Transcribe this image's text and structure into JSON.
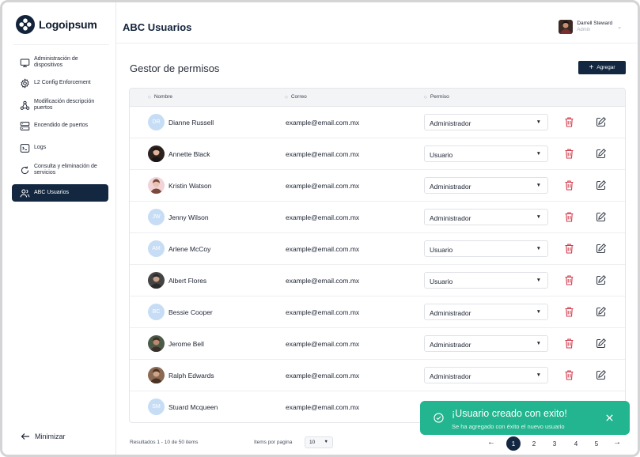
{
  "app": {
    "logo_text": "Logoipsum",
    "page_title": "ABC Usuarios"
  },
  "user": {
    "name": "Darrell Steward",
    "role": "Admin"
  },
  "sidebar": {
    "items": [
      {
        "label": "Administración de dispositivos",
        "icon": "monitor-icon",
        "active": false
      },
      {
        "label": "L2 Config Enforcement",
        "icon": "settings-icon",
        "active": false
      },
      {
        "label": "Modificación descripción puertos",
        "icon": "share-nodes-icon",
        "active": false
      },
      {
        "label": "Encendido de puertos",
        "icon": "server-icon",
        "active": false
      },
      {
        "label": "Logs",
        "icon": "terminal-icon",
        "active": false
      },
      {
        "label": "Consulta y eliminación de servicios",
        "icon": "refresh-icon",
        "active": false
      },
      {
        "label": "ABC Usuarios",
        "icon": "users-icon",
        "active": true
      }
    ],
    "minimize_label": "Minimizar"
  },
  "main": {
    "section_title": "Gestor de permisos",
    "add_button_label": "Agregar",
    "table": {
      "columns": [
        "Nombre",
        "Correo",
        "Permiso"
      ],
      "rows": [
        {
          "name": "Dianne Russell",
          "initials": "DR",
          "email": "example@email.com.mx",
          "permission": "Administrador"
        },
        {
          "name": "Annette Black",
          "initials": "",
          "email": "example@email.com.mx",
          "permission": "Usuario"
        },
        {
          "name": "Kristin Watson",
          "initials": "",
          "email": "example@email.com.mx",
          "permission": "Administrador"
        },
        {
          "name": "Jenny Wilson",
          "initials": "JW",
          "email": "example@email.com.mx",
          "permission": "Administrador"
        },
        {
          "name": "Arlene McCoy",
          "initials": "AM",
          "email": "example@email.com.mx",
          "permission": "Usuario"
        },
        {
          "name": "Albert Flores",
          "initials": "",
          "email": "example@email.com.mx",
          "permission": "Usuario"
        },
        {
          "name": "Bessie Cooper",
          "initials": "BC",
          "email": "example@email.com.mx",
          "permission": "Administrador"
        },
        {
          "name": "Jerome Bell",
          "initials": "",
          "email": "example@email.com.mx",
          "permission": "Administrador"
        },
        {
          "name": "Ralph Edwards",
          "initials": "",
          "email": "example@email.com.mx",
          "permission": "Administrador"
        },
        {
          "name": "Stuard Mcqueen",
          "initials": "SM",
          "email": "example@email.com.mx",
          "permission": ""
        }
      ]
    },
    "footer": {
      "results_text": "Resultados 1 - 10 de 50 items",
      "per_page_label": "Items por pagina",
      "per_page_value": "10",
      "pages": [
        "1",
        "2",
        "3",
        "4",
        "5"
      ],
      "current_page": "1"
    }
  },
  "toast": {
    "title": "¡Usuario creado con exito!",
    "message": "Se ha agregado con éxito el nuevo usuario"
  },
  "colors": {
    "primary": "#132840",
    "success": "#22b58f",
    "danger": "#d23b4c",
    "initials_bg": "#c6ddf5"
  }
}
